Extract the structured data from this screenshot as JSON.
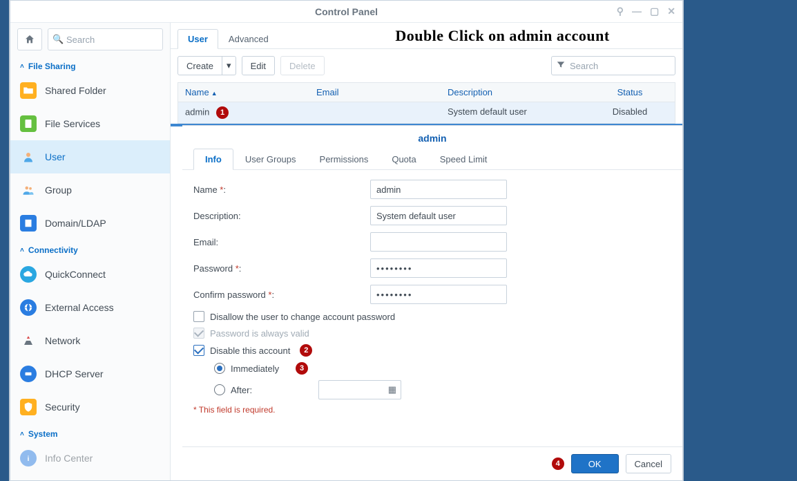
{
  "title": "Control Panel",
  "instruction": "Double Click on admin account",
  "sidebar": {
    "search_placeholder": "Search",
    "sections": {
      "file_sharing": "File Sharing",
      "connectivity": "Connectivity",
      "system": "System"
    },
    "items": {
      "shared_folder": "Shared Folder",
      "file_services": "File Services",
      "user": "User",
      "group": "Group",
      "domain_ldap": "Domain/LDAP",
      "quickconnect": "QuickConnect",
      "external_access": "External Access",
      "network": "Network",
      "dhcp_server": "DHCP Server",
      "security": "Security",
      "info_center": "Info Center"
    }
  },
  "tabs": {
    "user": "User",
    "advanced": "Advanced"
  },
  "toolbar": {
    "create": "Create",
    "edit": "Edit",
    "delete": "Delete",
    "search_placeholder": "Search"
  },
  "table": {
    "columns": {
      "name": "Name",
      "email": "Email",
      "description": "Description",
      "status": "Status"
    },
    "rows": [
      {
        "name": "admin",
        "email": "",
        "description": "System default user",
        "status": "Disabled"
      }
    ]
  },
  "modal": {
    "title": "admin",
    "tabs": {
      "info": "Info",
      "user_groups": "User Groups",
      "permissions": "Permissions",
      "quota": "Quota",
      "speed_limit": "Speed Limit"
    },
    "fields": {
      "name_label": "Name",
      "name_value": "admin",
      "description_label": "Description:",
      "description_value": "System default user",
      "email_label": "Email:",
      "email_value": "",
      "password_label": "Password",
      "password_value": "••••••••",
      "confirm_label": "Confirm password",
      "confirm_value": "••••••••"
    },
    "options": {
      "disallow_change": "Disallow the user to change account password",
      "always_valid": "Password is always valid",
      "disable_account": "Disable this account",
      "immediately": "Immediately",
      "after": "After:"
    },
    "required_text": "This field is required.",
    "buttons": {
      "ok": "OK",
      "cancel": "Cancel"
    }
  },
  "annotations": {
    "1": "1",
    "2": "2",
    "3": "3",
    "4": "4"
  },
  "required_marker": " *"
}
